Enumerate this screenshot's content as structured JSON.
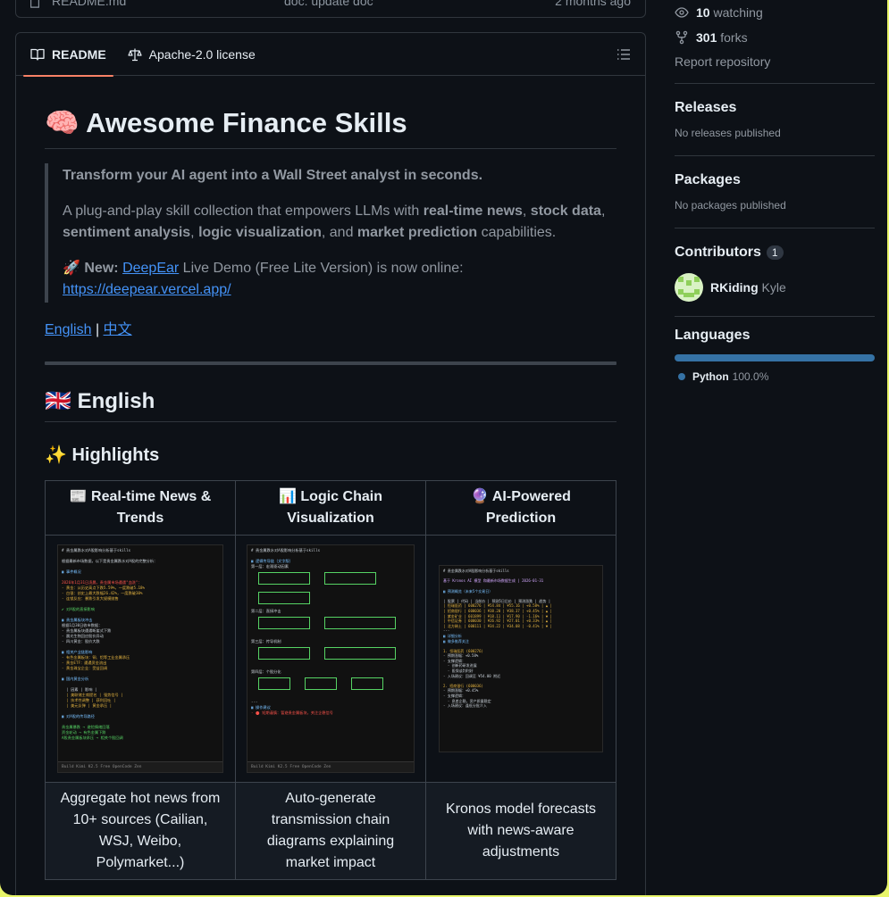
{
  "file_row": {
    "name": "README.md",
    "message": "doc: update doc",
    "age": "2 months ago"
  },
  "readme": {
    "tabs": [
      {
        "label": "README",
        "icon": "book-icon"
      },
      {
        "label": "Apache-2.0 license",
        "icon": "law-icon"
      }
    ],
    "title_emoji": "🧠",
    "title": "Awesome Finance Skills",
    "tagline": "Transform your AI agent into a Wall Street analyst in seconds.",
    "intro": {
      "t1": "A plug-and-play skill collection that empowers LLMs with ",
      "b1": "real-time news",
      "t2": ", ",
      "b2": "stock data",
      "t3": ", ",
      "b3": "sentiment analysis",
      "t4": ", ",
      "b4": "logic visualization",
      "t5": ", and ",
      "b5": "market prediction",
      "t6": " capabilities."
    },
    "news": {
      "emoji": "🚀",
      "label": "New:",
      "link": "DeepEar",
      "text": " Live Demo (Free Lite Version) is now online:",
      "url": "https://deepear.vercel.app/"
    },
    "lang_links": [
      "English",
      "中文"
    ],
    "lang_sep": "|",
    "section_flag": "🇬🇧",
    "section": "English",
    "highlights_emoji": "✨",
    "highlights": "Highlights",
    "table": {
      "headers": [
        {
          "emoji": "📰",
          "text": "Real-time News & Trends"
        },
        {
          "emoji": "📊",
          "text": "Logic Chain Visualization"
        },
        {
          "emoji": "🔮",
          "text": "AI-Powered Prediction"
        }
      ],
      "descriptions": [
        "Aggregate hot news from 10+ sources (Cailian, WSJ, Weibo, Polymarket...)",
        "Auto-generate transmission chain diagrams explaining market impact",
        "Kronos model forecasts with news-aware adjustments"
      ],
      "shots": [
        {
          "header": "# 贵金属跌水对A股影响分析基于skills",
          "footer": "Build  Kimi K2.5 Free  OpenCode Zen"
        },
        {
          "header": "# 贵金属跌水对A股影响分析基于skills",
          "footer": "Build  Kimi K2.5 Free  OpenCode Zen"
        },
        {
          "header": "# 贵金属跌水对A股影响分析基于skills",
          "footer": ""
        }
      ]
    }
  },
  "sidebar": {
    "watching_count": "10",
    "watching_label": "watching",
    "forks_count": "301",
    "forks_label": "forks",
    "report": "Report repository",
    "releases_title": "Releases",
    "releases_text": "No releases published",
    "packages_title": "Packages",
    "packages_text": "No packages published",
    "contributors_title": "Contributors",
    "contributors_count": "1",
    "contributor_login": "RKiding",
    "contributor_name": "Kyle",
    "languages_title": "Languages",
    "language_name": "Python",
    "language_pct": "100.0%",
    "language_color": "#3572a5"
  }
}
